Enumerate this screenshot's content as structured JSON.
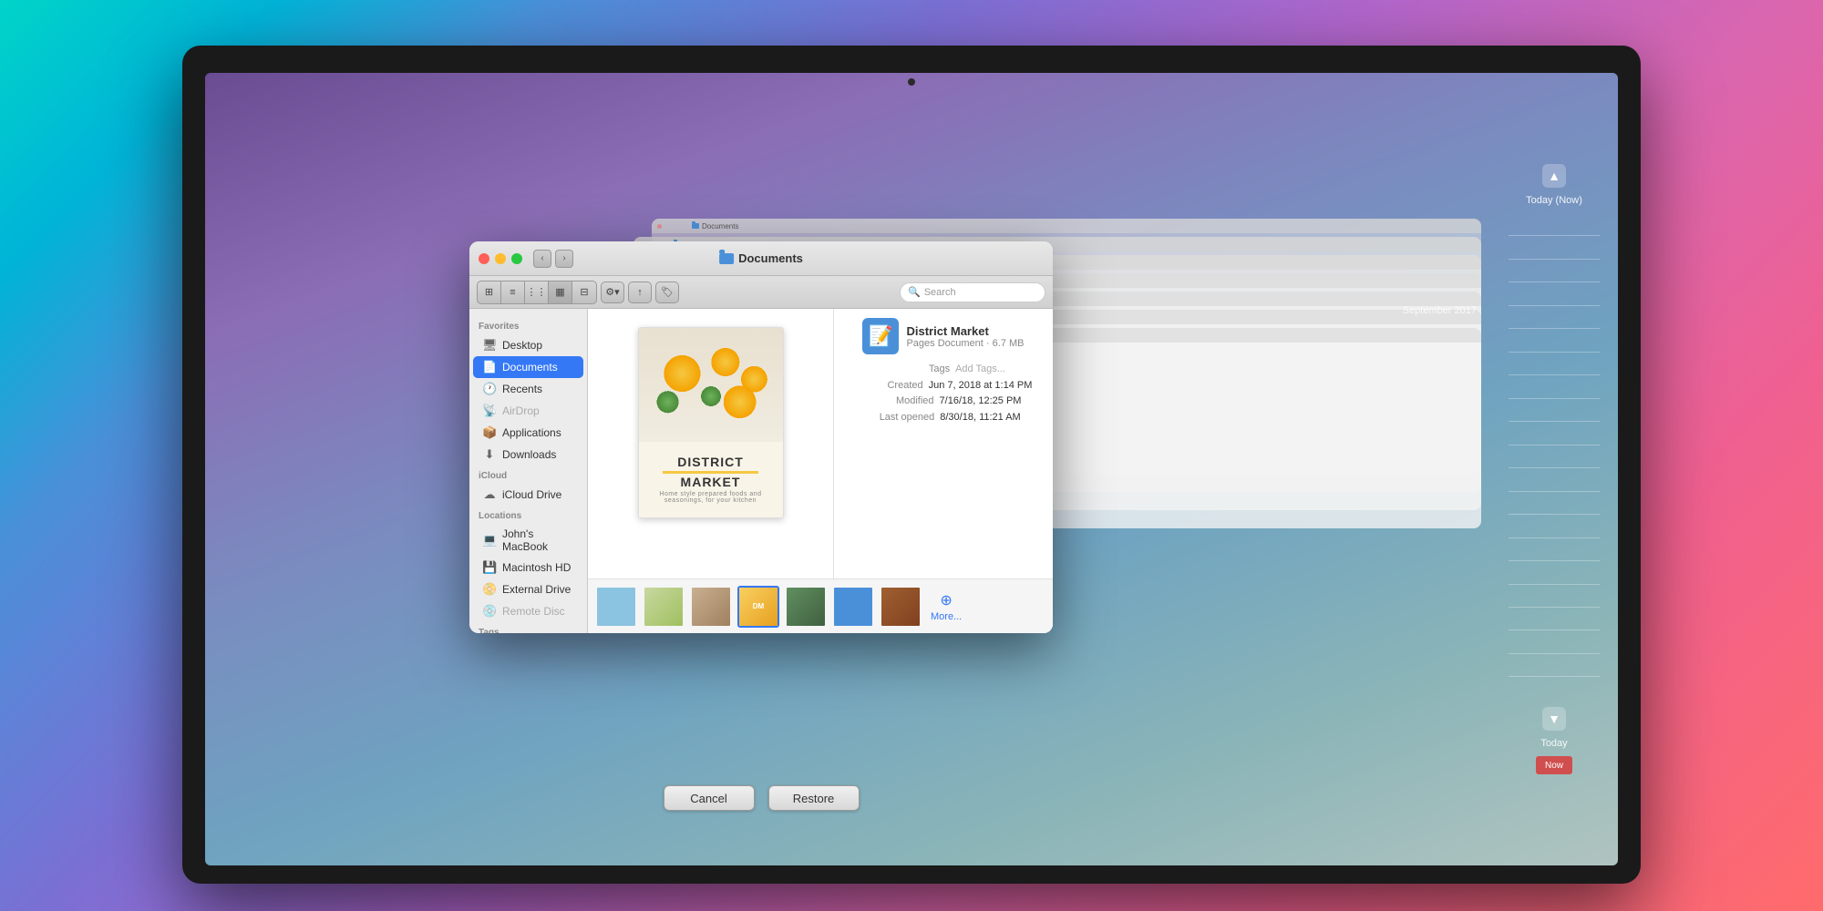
{
  "background": {
    "gradient": "linear-gradient(135deg, #00d4c8, #7b6fd4, #d966b0, #f06090)"
  },
  "finder": {
    "title": "Documents",
    "toolbar": {
      "view_icons": [
        "⊞",
        "≡",
        "⋮⋮",
        "▦",
        "⊟"
      ],
      "action_buttons": [
        "⚙",
        "↑",
        "🏷"
      ],
      "search_placeholder": "Search"
    },
    "sidebar": {
      "sections": [
        {
          "label": "Favorites",
          "items": [
            {
              "name": "Desktop",
              "icon": "🖥",
              "active": false
            },
            {
              "name": "Documents",
              "icon": "📄",
              "active": true
            },
            {
              "name": "Recents",
              "icon": "🕐",
              "active": false
            },
            {
              "name": "AirDrop",
              "icon": "📡",
              "active": false,
              "dimmed": true
            },
            {
              "name": "Applications",
              "icon": "📦",
              "active": false
            },
            {
              "name": "Downloads",
              "icon": "⬇",
              "active": false
            }
          ]
        },
        {
          "label": "iCloud",
          "items": [
            {
              "name": "iCloud Drive",
              "icon": "☁",
              "active": false
            }
          ]
        },
        {
          "label": "Locations",
          "items": [
            {
              "name": "John's MacBook",
              "icon": "💻",
              "active": false
            },
            {
              "name": "Macintosh HD",
              "icon": "💾",
              "active": false
            },
            {
              "name": "External Drive",
              "icon": "📀",
              "active": false
            },
            {
              "name": "Remote Disc",
              "icon": "💿",
              "active": false,
              "dimmed": true
            }
          ]
        },
        {
          "label": "Tags",
          "items": []
        }
      ]
    },
    "preview": {
      "file_name": "District Market",
      "file_type": "Pages Document",
      "file_size": "6.7 MB",
      "tags_label": "Tags",
      "tags_add": "Add Tags...",
      "created_label": "Created",
      "created_value": "Jun 7, 2018 at 1:14 PM",
      "modified_label": "Modified",
      "modified_value": "7/16/18, 12:25 PM",
      "last_opened_label": "Last opened",
      "last_opened_value": "8/30/18, 11:21 AM"
    },
    "doc_content": {
      "title_line1": "DISTRICT",
      "title_line2": "MARKET",
      "subtitle": "Home style prepared foods and seasonings, for your kitchen"
    },
    "thumbnails": [
      {
        "id": 1,
        "color": "#8bc4e0",
        "selected": false
      },
      {
        "id": 2,
        "color": "#a0c878",
        "selected": false
      },
      {
        "id": 3,
        "color": "#9b8878",
        "selected": false
      },
      {
        "id": 4,
        "color": "#e8c840",
        "selected": true
      },
      {
        "id": 5,
        "color": "#4a8a50",
        "selected": false
      },
      {
        "id": 6,
        "color": "#4a90d9",
        "selected": false
      },
      {
        "id": 7,
        "color": "#c87840",
        "selected": false
      }
    ],
    "more_label": "More...",
    "bottom_buttons": {
      "cancel": "Cancel",
      "restore": "Restore"
    }
  },
  "time_machine": {
    "date_label": "September 2017",
    "today_now": "Today (Now)",
    "today": "Today"
  },
  "stacked_windows": [
    "Documents",
    "Documents",
    "Documents",
    "Documents",
    "Documents",
    "Documents",
    "Documents",
    "Documents"
  ]
}
